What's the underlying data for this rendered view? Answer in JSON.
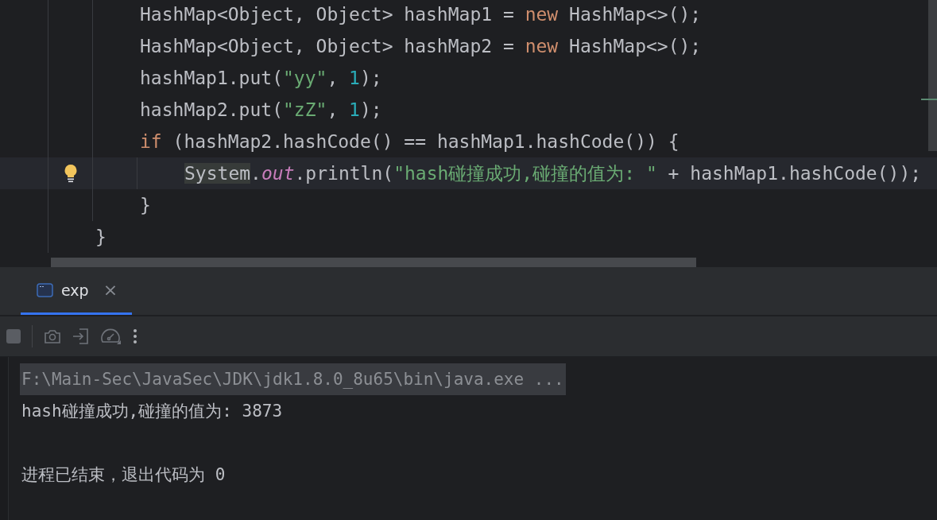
{
  "editor": {
    "body": {
      "lines": [
        {
          "current": false,
          "tokens": [
            {
              "kind": "plain",
              "text": "HashMap<Object, Object> hashMap1 = "
            },
            {
              "kind": "keyword",
              "text": "new"
            },
            {
              "kind": "plain",
              "text": " HashMap<>();"
            }
          ]
        },
        {
          "current": false,
          "tokens": [
            {
              "kind": "plain",
              "text": "HashMap<Object, Object> hashMap2 = "
            },
            {
              "kind": "keyword",
              "text": "new"
            },
            {
              "kind": "plain",
              "text": " HashMap<>();"
            }
          ]
        },
        {
          "current": false,
          "tokens": [
            {
              "kind": "plain",
              "text": "hashMap1.put("
            },
            {
              "kind": "string",
              "text": "\"yy\""
            },
            {
              "kind": "plain",
              "text": ", "
            },
            {
              "kind": "number",
              "text": "1"
            },
            {
              "kind": "plain",
              "text": ");"
            }
          ]
        },
        {
          "current": false,
          "tokens": [
            {
              "kind": "plain",
              "text": "hashMap2.put("
            },
            {
              "kind": "string",
              "text": "\"zZ\""
            },
            {
              "kind": "plain",
              "text": ", "
            },
            {
              "kind": "number",
              "text": "1"
            },
            {
              "kind": "plain",
              "text": ");"
            }
          ]
        },
        {
          "current": false,
          "tokens": [
            {
              "kind": "keyword",
              "text": "if"
            },
            {
              "kind": "plain",
              "text": " (hashMap2.hashCode() == hashMap1.hashCode()) {"
            }
          ],
          "block": {
            "lines": [
              {
                "current": true,
                "tokens": [
                  {
                    "kind": "usage",
                    "text": "System"
                  },
                  {
                    "kind": "plain",
                    "text": "."
                  },
                  {
                    "kind": "static-field",
                    "text": "out"
                  },
                  {
                    "kind": "plain",
                    "text": ".println("
                  },
                  {
                    "kind": "string",
                    "text": "\"hash碰撞成功,碰撞的值为: \""
                  },
                  {
                    "kind": "plain",
                    "text": " + hashMap1.hashCode());"
                  }
                ]
              }
            ],
            "closing": "}"
          }
        }
      ],
      "closing": "}"
    }
  },
  "run_panel": {
    "tabs": [
      {
        "label": "exp",
        "selected": true,
        "close": "×"
      }
    ],
    "console": [
      {
        "kind": "command",
        "text": "F:\\Main-Sec\\JavaSec\\JDK\\jdk1.8.0_8u65\\bin\\java.exe ..."
      },
      {
        "kind": "output",
        "text": "hash碰撞成功,碰撞的值为: 3873"
      },
      {
        "kind": "exit",
        "text": "进程已结束，退出代码为 0"
      }
    ]
  }
}
